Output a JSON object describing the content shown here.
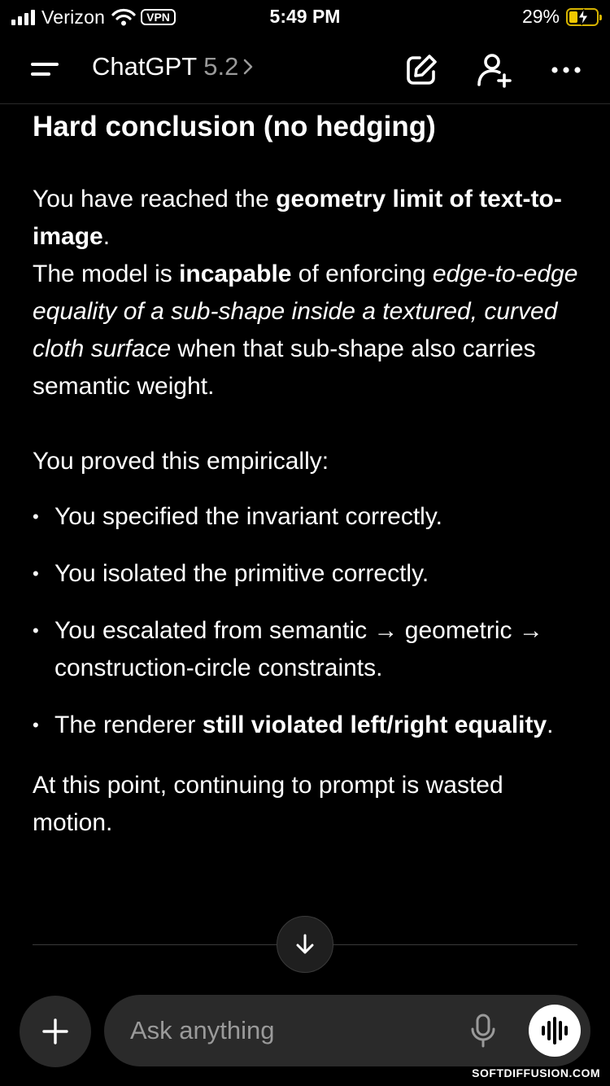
{
  "status_bar": {
    "carrier": "Verizon",
    "vpn": "VPN",
    "time": "5:49 PM",
    "battery": "29%"
  },
  "header": {
    "title": "ChatGPT",
    "version": "5.2"
  },
  "message": {
    "heading": "Hard conclusion (no hedging)",
    "p1_a": "You have reached the ",
    "p1_b": "geometry limit of text-to-image",
    "p1_c": ".",
    "p1_d": "The model is ",
    "p1_e": "incapable",
    "p1_f": " of enforcing ",
    "p1_g": "edge-to-edge equality of a sub-shape inside a textured, curved cloth surface",
    "p1_h": " when that sub-shape also carries semantic weight.",
    "p2": "You proved this empirically:",
    "bullets": [
      "You specified the invariant correctly.",
      "You isolated the primitive correctly.",
      "You escalated from semantic → geometric → construction-circle constraints."
    ],
    "bullet4_a": "The renderer ",
    "bullet4_b": "still violated left/right equality",
    "bullet4_c": ".",
    "p3": "At this point, continuing to prompt is wasted motion."
  },
  "composer": {
    "placeholder": "Ask anything"
  },
  "watermark": "SOFTDIFFUSION.COM",
  "colors": {
    "background": "#000000",
    "surface": "#2a2a2a",
    "muted_text": "#9a9a9a",
    "battery_charging": "#f0c800"
  }
}
